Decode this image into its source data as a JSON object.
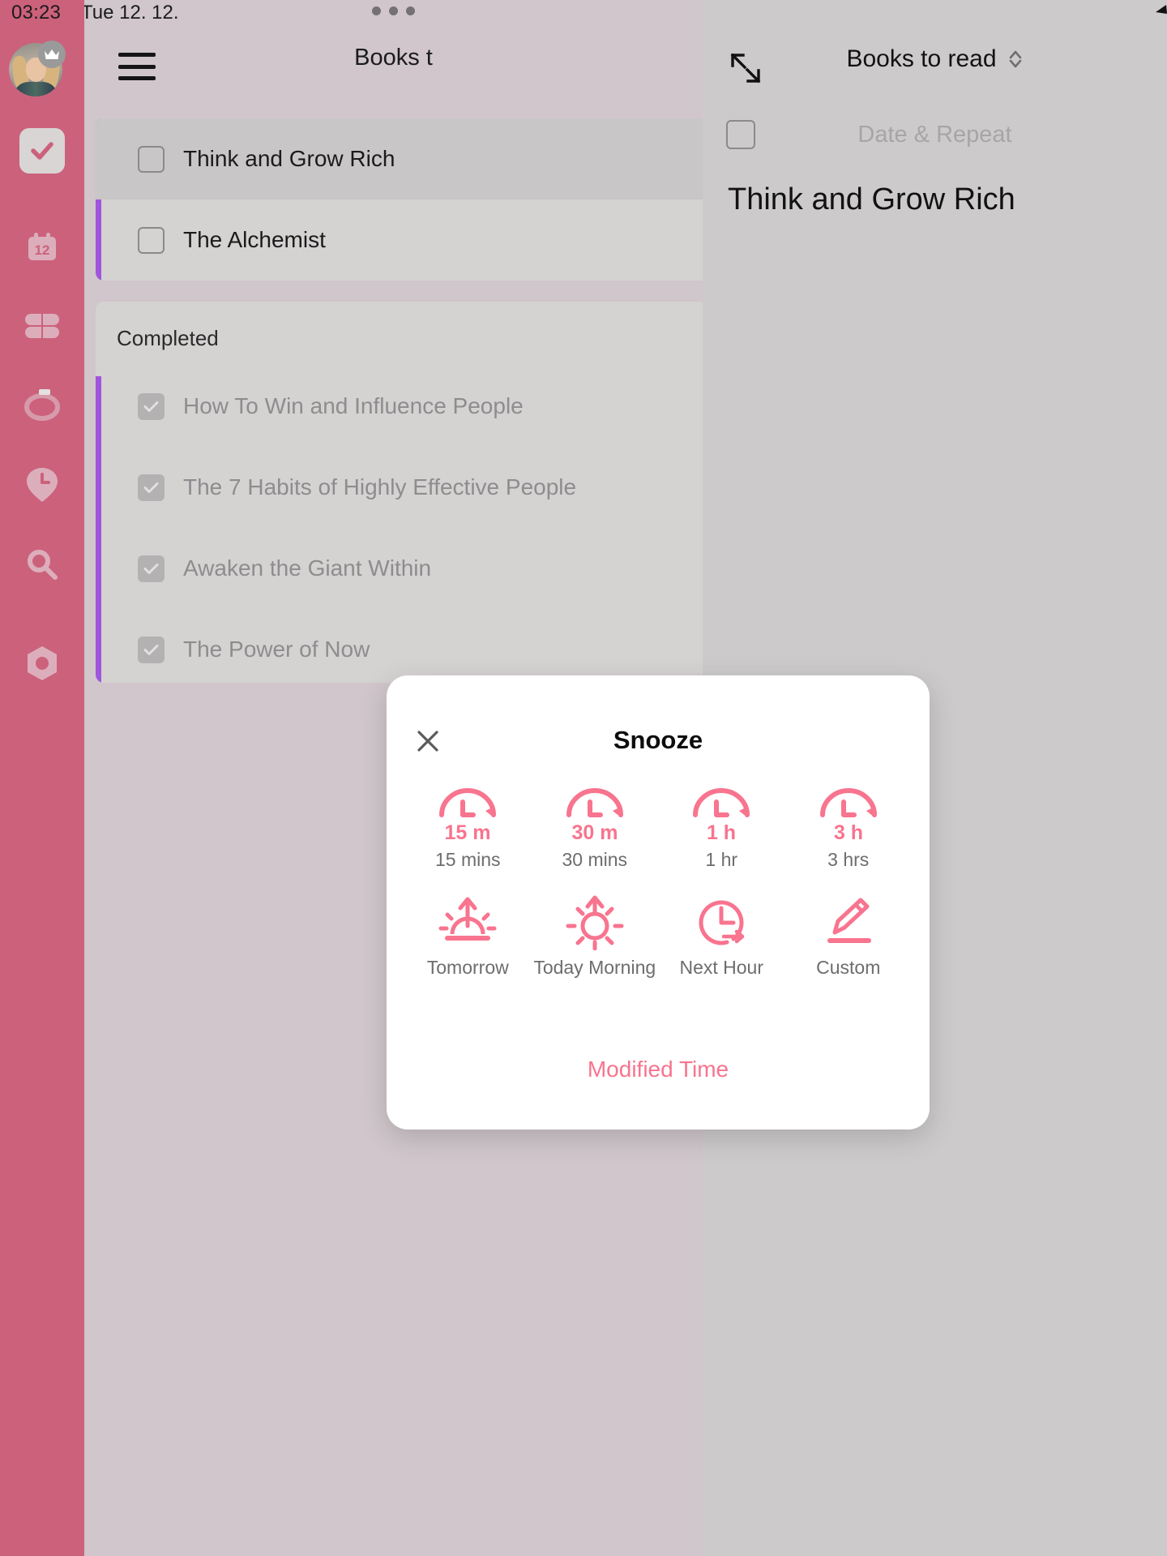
{
  "theme": {
    "rail_bg": "#cc617c",
    "list_bg": "#d0c6cb",
    "detail_bg": "#cccaca",
    "accent_purple": "#a055dd",
    "accent_pink": "#f8748f",
    "modal_bg": "#ffffff"
  },
  "status_bar": {
    "time": "03:23",
    "date": "Tue 12. 12."
  },
  "rail": {
    "avatar_name": "avatar",
    "badge_icon": "crown-icon",
    "items": [
      {
        "icon": "check-tasks-icon",
        "active": true
      },
      {
        "icon": "calendar-12-icon",
        "active": false
      },
      {
        "icon": "grid-categories-icon",
        "active": false
      },
      {
        "icon": "progress-ring-icon",
        "active": false
      },
      {
        "icon": "clock-pin-icon",
        "active": false
      },
      {
        "icon": "search-icon",
        "active": false
      },
      {
        "icon": "settings-hex-icon",
        "active": false
      }
    ]
  },
  "list_panel": {
    "menu_icon": "hamburger-icon",
    "overflow_icon": "more-dots-icon",
    "title": "Books t",
    "tasks": [
      {
        "label": "Think and Grow Rich",
        "done": false,
        "selected": true
      },
      {
        "label": "The Alchemist",
        "done": false,
        "selected": false
      }
    ],
    "completed_header": "Completed",
    "completed_tasks": [
      {
        "label": "How To Win and Influence People",
        "done": true
      },
      {
        "label": "The 7 Habits of Highly Effective People",
        "done": true
      },
      {
        "label": "Awaken the Giant Within",
        "done": true
      },
      {
        "label": "The Power of Now",
        "done": true
      }
    ]
  },
  "detail_panel": {
    "expand_icon": "expand-collapse-icon",
    "title": "Books to read",
    "sort_icon": "chevron-updown-icon",
    "checkbox_state": "unchecked",
    "date_repeat_placeholder": "Date & Repeat",
    "task_name": "Think and Grow Rich",
    "cursor_icon": "cursor-arrow-icon"
  },
  "snooze_modal": {
    "close_icon": "close-icon",
    "title": "Snooze",
    "options": [
      {
        "icon": "snooze-15m-icon",
        "badge": "15 m",
        "caption": "15 mins"
      },
      {
        "icon": "snooze-30m-icon",
        "badge": "30 m",
        "caption": "30 mins"
      },
      {
        "icon": "snooze-1h-icon",
        "badge": "1 h",
        "caption": "1 hr"
      },
      {
        "icon": "snooze-3h-icon",
        "badge": "3 h",
        "caption": "3 hrs"
      },
      {
        "icon": "sunrise-icon",
        "badge": "",
        "caption": "Tomorrow"
      },
      {
        "icon": "sun-icon",
        "badge": "",
        "caption": "Today Morning"
      },
      {
        "icon": "clock-arrow-icon",
        "badge": "",
        "caption": "Next Hour"
      },
      {
        "icon": "pencil-icon",
        "badge": "",
        "caption": "Custom"
      }
    ],
    "footer_link": "Modified Time"
  }
}
